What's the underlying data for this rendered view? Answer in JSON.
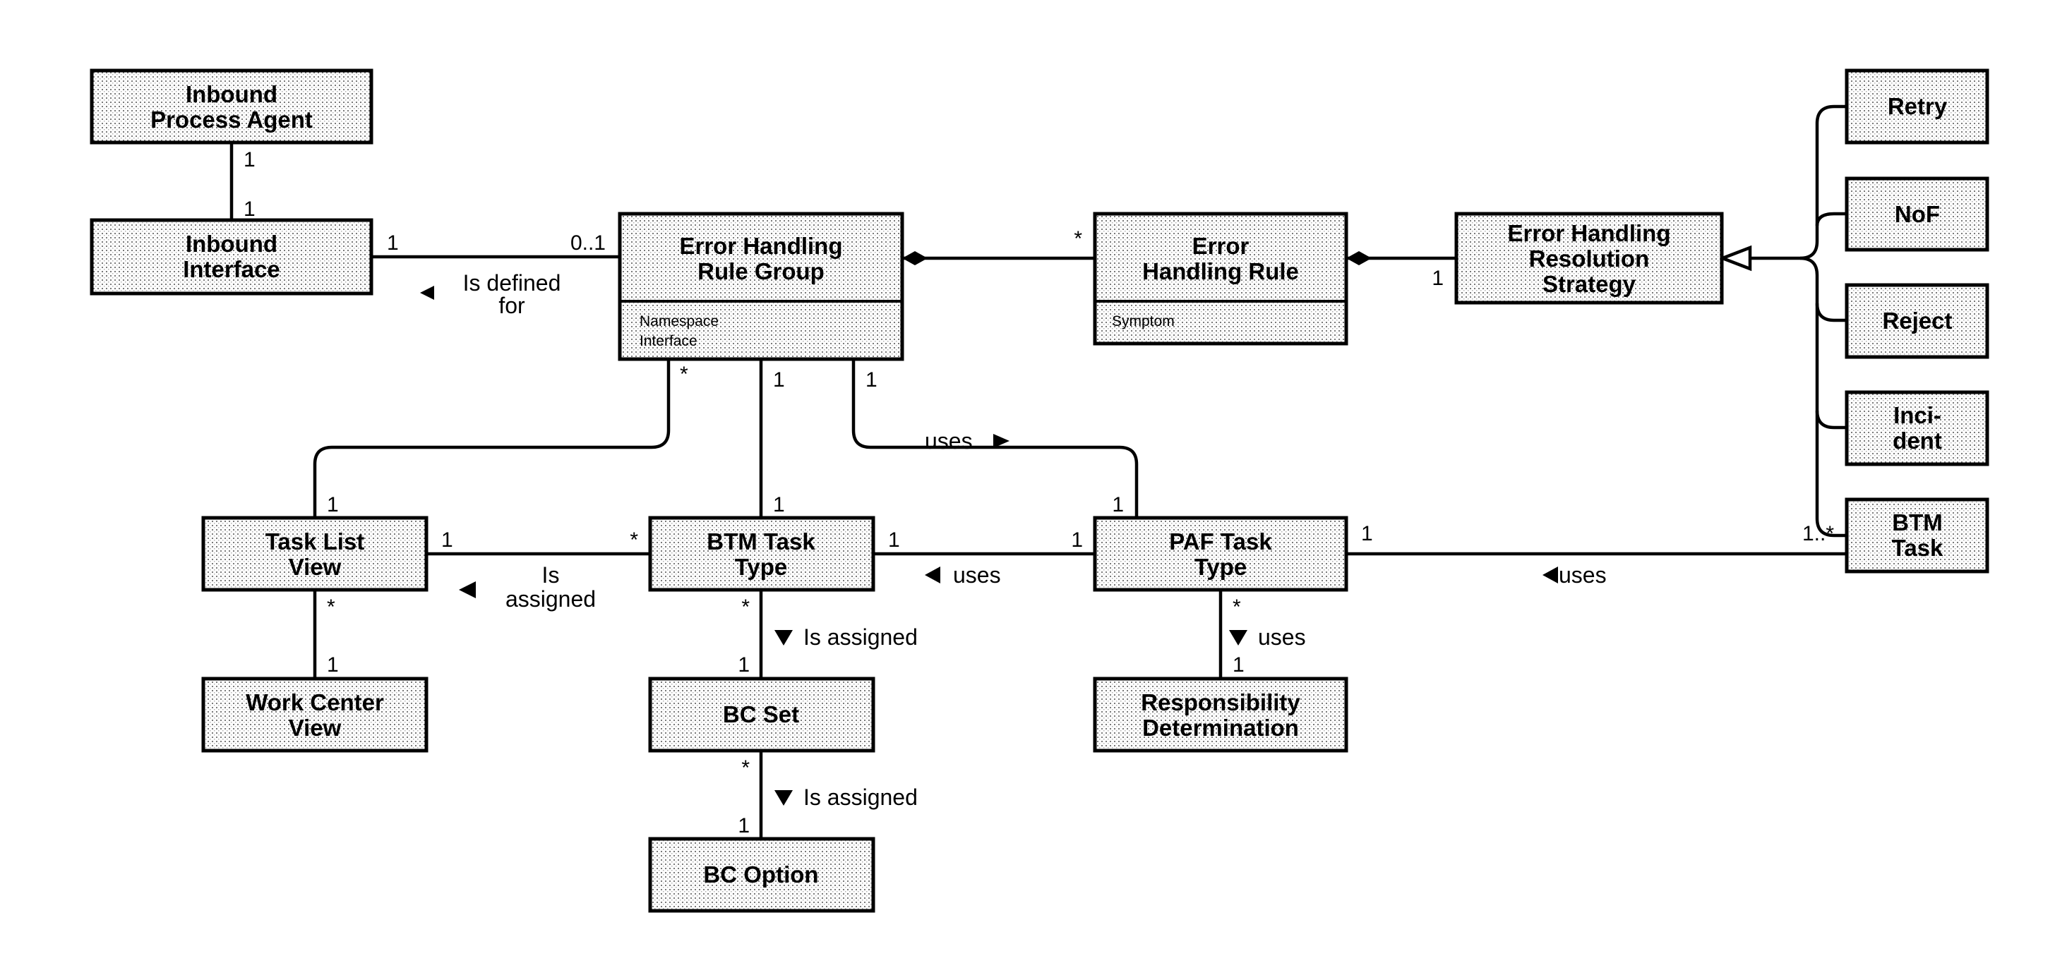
{
  "diagram": {
    "type": "UML class diagram",
    "classes": {
      "inbound_process_agent": {
        "lines": [
          "Inbound",
          "Process Agent"
        ]
      },
      "inbound_interface": {
        "lines": [
          "Inbound",
          "Interface"
        ]
      },
      "eh_rule_group": {
        "lines": [
          "Error Handling",
          "Rule Group"
        ],
        "attributes": [
          "Namespace",
          "Interface"
        ]
      },
      "eh_rule": {
        "lines": [
          "Error",
          "Handling Rule"
        ],
        "attributes": [
          "Symptom"
        ]
      },
      "eh_resolution_strategy": {
        "lines": [
          "Error Handling",
          "Resolution",
          "Strategy"
        ]
      },
      "retry": {
        "lines": [
          "Retry"
        ]
      },
      "nof": {
        "lines": [
          "NoF"
        ]
      },
      "reject": {
        "lines": [
          "Reject"
        ]
      },
      "incident": {
        "lines": [
          "Inci-",
          "dent"
        ]
      },
      "btm_task": {
        "lines": [
          "BTM",
          "Task"
        ]
      },
      "task_list_view": {
        "lines": [
          "Task List",
          "View"
        ]
      },
      "btm_task_type": {
        "lines": [
          "BTM Task",
          "Type"
        ]
      },
      "paf_task_type": {
        "lines": [
          "PAF Task",
          "Type"
        ]
      },
      "work_center_view": {
        "lines": [
          "Work Center",
          "View"
        ]
      },
      "bc_set": {
        "lines": [
          "BC Set"
        ]
      },
      "responsibility_determination": {
        "lines": [
          "Responsibility",
          "Determination"
        ]
      },
      "bc_option": {
        "lines": [
          "BC Option"
        ]
      }
    },
    "associations": {
      "ipa_ii": {
        "from_mult": "1",
        "to_mult": "1"
      },
      "ii_ehrg": {
        "from_mult": "1",
        "to_mult": "0..1",
        "label": [
          "Is defined",
          "for"
        ],
        "direction": "left"
      },
      "ehrg_ehr": {
        "to_mult": "*",
        "kind": "composition"
      },
      "ehr_ehrs": {
        "to_mult": "1",
        "kind": "composition"
      },
      "ehrg_tlv": {
        "from_mult": "*",
        "to_mult": "1"
      },
      "ehrg_btt": {
        "from_mult": "1",
        "to_mult": "1"
      },
      "ehrg_paf": {
        "from_mult": "1",
        "to_mult": "1",
        "label": [
          "uses"
        ],
        "direction": "right"
      },
      "tlv_btt": {
        "from_mult": "1",
        "to_mult": "*",
        "label": [
          "Is",
          "assigned"
        ],
        "direction": "left"
      },
      "btt_paf": {
        "from_mult": "1",
        "to_mult": "1",
        "label": [
          "uses"
        ],
        "direction": "left"
      },
      "paf_btmtask": {
        "from_mult": "1",
        "to_mult": "1..*",
        "label": [
          "uses"
        ],
        "direction": "left"
      },
      "tlv_wcv": {
        "from_mult": "*",
        "to_mult": "1"
      },
      "btt_bcset": {
        "from_mult": "*",
        "to_mult": "1",
        "label": [
          "Is assigned"
        ],
        "direction": "down"
      },
      "paf_rd": {
        "from_mult": "*",
        "to_mult": "1",
        "label": [
          "uses"
        ],
        "direction": "down"
      },
      "bcset_bcoption": {
        "from_mult": "*",
        "to_mult": "1",
        "label": [
          "Is assigned"
        ],
        "direction": "down"
      }
    },
    "generalization": {
      "parent": "Error Handling Resolution Strategy",
      "children": [
        "Retry",
        "NoF",
        "Reject",
        "Incident",
        "BTM Task"
      ]
    },
    "colors": {
      "line": "#000000",
      "fill_dot": "#000000",
      "background": "#ffffff"
    }
  }
}
